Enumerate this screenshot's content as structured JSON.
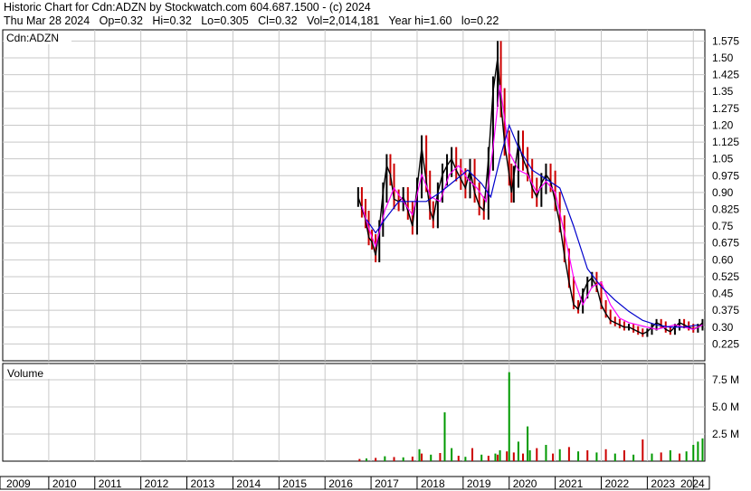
{
  "header": {
    "line1": "Historic Chart for Cdn:ADZN by Stockwatch.com 604.687.1500 - (c) 2024",
    "line2": "Thu Mar 28 2024   Op=0.32   Hi=0.32   Lo=0.305   Cl=0.32   Vol=2,014,181   Year hi=1.60   lo=0.22"
  },
  "chart_data": [
    {
      "type": "line",
      "title": "Cdn:ADZN",
      "ylim": [
        0.15,
        1.625
      ],
      "ytick_labels": [
        "1.575",
        "1.50",
        "1.425",
        "1.35",
        "1.275",
        "1.20",
        "1.125",
        "1.05",
        "0.975",
        "0.90",
        "0.825",
        "0.75",
        "0.675",
        "0.60",
        "0.525",
        "0.45",
        "0.375",
        "0.30",
        "0.225"
      ],
      "yticks": [
        1.575,
        1.5,
        1.425,
        1.35,
        1.275,
        1.2,
        1.125,
        1.05,
        0.975,
        0.9,
        0.825,
        0.75,
        0.675,
        0.6,
        0.525,
        0.45,
        0.375,
        0.3,
        0.225
      ],
      "x_labels": [
        "2009",
        "2010",
        "2011",
        "2012",
        "2013",
        "2014",
        "2015",
        "2016",
        "2017",
        "2018",
        "2019",
        "2020",
        "2021",
        "2022",
        "2023",
        "2024"
      ],
      "xlim": [
        2009.0,
        2024.25
      ],
      "grid": true,
      "colors": {
        "price": "#000000",
        "down": "#cc0000",
        "ma_short": "#ff00ff",
        "ma_long": "#0000cc"
      },
      "series": [
        {
          "style": "price",
          "x": [
            2016.72,
            2016.8,
            2016.88,
            2016.95,
            2017.02,
            2017.1,
            2017.18,
            2017.26,
            2017.34,
            2017.42,
            2017.5,
            2017.6,
            2017.7,
            2017.8,
            2017.9,
            2018.0,
            2018.1,
            2018.2,
            2018.28,
            2018.35,
            2018.45,
            2018.55,
            2018.65,
            2018.75,
            2018.85,
            2018.95,
            2019.05,
            2019.15,
            2019.25,
            2019.35,
            2019.45,
            2019.55,
            2019.65,
            2019.75,
            2019.82,
            2019.9,
            2020.0,
            2020.05,
            2020.1,
            2020.2,
            2020.3,
            2020.4,
            2020.5,
            2020.6,
            2020.7,
            2020.8,
            2020.9,
            2021.0,
            2021.1,
            2021.2,
            2021.3,
            2021.4,
            2021.5,
            2021.6,
            2021.7,
            2021.8,
            2021.9,
            2022.0,
            2022.1,
            2022.2,
            2022.3,
            2022.4,
            2022.5,
            2022.6,
            2022.7,
            2022.8,
            2022.9,
            2023.0,
            2023.1,
            2023.2,
            2023.3,
            2023.4,
            2023.5,
            2023.6,
            2023.7,
            2023.8,
            2023.9,
            2024.0,
            2024.1,
            2024.2
          ],
          "y": [
            0.88,
            0.83,
            0.78,
            0.7,
            0.68,
            0.62,
            0.74,
            0.9,
            1.02,
            0.98,
            0.87,
            0.86,
            0.88,
            0.82,
            0.75,
            0.92,
            1.1,
            0.95,
            0.82,
            0.78,
            0.9,
            0.98,
            1.02,
            1.05,
            1.0,
            0.96,
            0.92,
            1.0,
            0.9,
            0.84,
            0.82,
            1.05,
            1.35,
            1.5,
            1.3,
            1.12,
            0.98,
            0.9,
            0.97,
            1.12,
            1.05,
            1.0,
            0.92,
            0.88,
            0.94,
            0.98,
            0.95,
            0.86,
            0.76,
            0.62,
            0.5,
            0.4,
            0.38,
            0.45,
            0.5,
            0.52,
            0.48,
            0.4,
            0.36,
            0.33,
            0.32,
            0.31,
            0.3,
            0.3,
            0.29,
            0.28,
            0.27,
            0.28,
            0.3,
            0.32,
            0.31,
            0.29,
            0.28,
            0.3,
            0.32,
            0.31,
            0.3,
            0.29,
            0.3,
            0.32
          ]
        },
        {
          "style": "ma_short",
          "x": [
            2016.8,
            2016.95,
            2017.1,
            2017.3,
            2017.5,
            2017.7,
            2017.9,
            2018.1,
            2018.3,
            2018.5,
            2018.7,
            2018.9,
            2019.1,
            2019.3,
            2019.5,
            2019.65,
            2019.8,
            2020.0,
            2020.2,
            2020.4,
            2020.6,
            2020.8,
            2021.0,
            2021.2,
            2021.4,
            2021.6,
            2021.8,
            2022.0,
            2022.2,
            2022.4,
            2022.6,
            2022.8,
            2023.0,
            2023.2,
            2023.4,
            2023.6,
            2023.8,
            2024.0,
            2024.2
          ],
          "y": [
            0.84,
            0.74,
            0.66,
            0.82,
            0.92,
            0.86,
            0.8,
            0.98,
            0.88,
            0.86,
            0.98,
            1.02,
            0.96,
            0.92,
            0.86,
            1.1,
            1.38,
            1.08,
            1.0,
            0.98,
            0.9,
            0.95,
            0.9,
            0.72,
            0.52,
            0.4,
            0.48,
            0.5,
            0.4,
            0.34,
            0.32,
            0.31,
            0.3,
            0.29,
            0.3,
            0.31,
            0.3,
            0.29,
            0.31
          ]
        },
        {
          "style": "ma_long",
          "x": [
            2016.9,
            2017.1,
            2017.3,
            2017.6,
            2017.9,
            2018.2,
            2018.5,
            2018.8,
            2019.1,
            2019.4,
            2019.6,
            2019.8,
            2020.0,
            2020.2,
            2020.5,
            2020.8,
            2021.1,
            2021.4,
            2021.7,
            2022.0,
            2022.3,
            2022.6,
            2022.9,
            2023.2,
            2023.5,
            2023.8,
            2024.1
          ],
          "y": [
            0.78,
            0.72,
            0.78,
            0.86,
            0.86,
            0.86,
            0.9,
            0.95,
            1.0,
            0.94,
            0.88,
            1.05,
            1.2,
            1.1,
            1.0,
            0.96,
            0.92,
            0.75,
            0.56,
            0.48,
            0.42,
            0.37,
            0.33,
            0.31,
            0.3,
            0.3,
            0.31
          ]
        }
      ]
    },
    {
      "type": "bar",
      "title": "Volume",
      "ylim": [
        0,
        9000000
      ],
      "ytick_labels": [
        "7.5 M",
        "5.0 M",
        "2.5 M"
      ],
      "yticks": [
        7500000,
        5000000,
        2500000
      ],
      "colors": {
        "up": "#009900",
        "down": "#cc0000"
      },
      "x": [
        2016.75,
        2016.9,
        2017.1,
        2017.3,
        2017.5,
        2017.7,
        2017.9,
        2018.05,
        2018.1,
        2018.3,
        2018.5,
        2018.6,
        2018.75,
        2018.9,
        2019.05,
        2019.2,
        2019.4,
        2019.55,
        2019.7,
        2019.75,
        2019.8,
        2019.95,
        2020.0,
        2020.1,
        2020.2,
        2020.3,
        2020.4,
        2020.45,
        2020.6,
        2020.8,
        2020.95,
        2021.1,
        2021.3,
        2021.5,
        2021.7,
        2021.9,
        2022.1,
        2022.3,
        2022.5,
        2022.7,
        2022.9,
        2023.1,
        2023.3,
        2023.5,
        2023.7,
        2023.85,
        2024.0,
        2024.1,
        2024.2
      ],
      "values": [
        200000,
        250000,
        300000,
        450000,
        380000,
        350000,
        420000,
        1100000,
        700000,
        600000,
        750000,
        4500000,
        1200000,
        500000,
        400000,
        1200000,
        600000,
        500000,
        700000,
        600000,
        1000000,
        900000,
        8200000,
        800000,
        1800000,
        700000,
        3200000,
        1000000,
        1200000,
        1500000,
        700000,
        1100000,
        1300000,
        900000,
        1000000,
        800000,
        1100000,
        700000,
        1000000,
        600000,
        2000000,
        700000,
        800000,
        1000000,
        700000,
        900000,
        1500000,
        1800000,
        2100000
      ],
      "up": [
        false,
        true,
        false,
        true,
        false,
        true,
        false,
        true,
        false,
        true,
        false,
        true,
        true,
        false,
        true,
        false,
        true,
        false,
        true,
        false,
        true,
        false,
        true,
        false,
        true,
        false,
        true,
        true,
        false,
        true,
        false,
        true,
        false,
        true,
        false,
        true,
        false,
        true,
        false,
        true,
        false,
        true,
        false,
        true,
        false,
        true,
        true,
        true,
        true
      ]
    }
  ]
}
